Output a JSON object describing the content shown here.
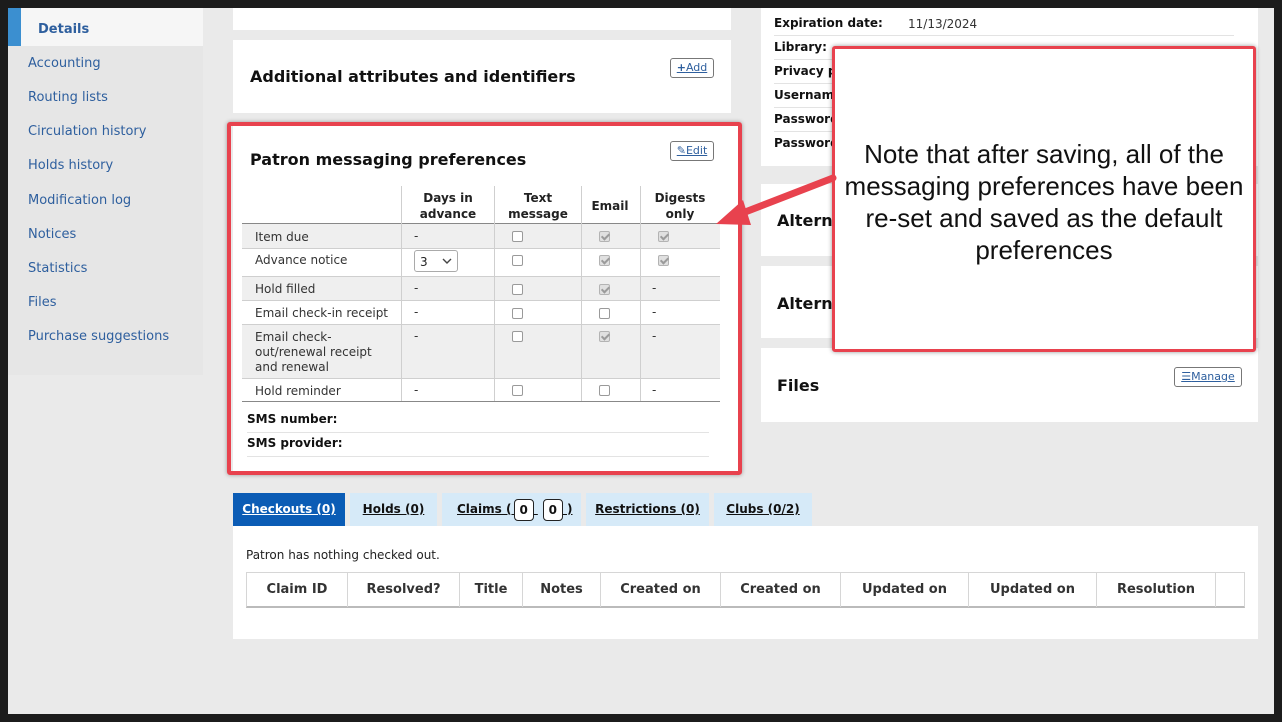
{
  "sidebar": {
    "active": "Details",
    "items": [
      "Accounting",
      "Routing lists",
      "Circulation history",
      "Holds history",
      "Modification log",
      "Notices",
      "Statistics",
      "Files",
      "Purchase suggestions"
    ]
  },
  "attributes_panel": {
    "title": "Additional attributes and identifiers",
    "add_label": "Add"
  },
  "messaging": {
    "title": "Patron messaging preferences",
    "edit_label": "Edit",
    "columns": [
      "Days in advance",
      "Text message",
      "Email",
      "Digests only"
    ],
    "rows": [
      {
        "label": "Item due",
        "days": "-",
        "text": false,
        "email": true,
        "digest": true,
        "digest_text": ""
      },
      {
        "label": "Advance notice",
        "days": "3",
        "text": false,
        "email": true,
        "digest": true,
        "digest_text": ""
      },
      {
        "label": "Hold filled",
        "days": "-",
        "text": false,
        "email": true,
        "digest": false,
        "digest_text": "-"
      },
      {
        "label": "Email check-in receipt",
        "days": "-",
        "text": false,
        "email": false,
        "digest": false,
        "digest_text": "-"
      },
      {
        "label": "Email check-out/renewal receipt and renewal",
        "days": "-",
        "text": false,
        "email": true,
        "digest": false,
        "digest_text": "-"
      },
      {
        "label": "Hold reminder",
        "days": "-",
        "text": false,
        "email": false,
        "digest": false,
        "digest_text": "-"
      }
    ],
    "sms_number_label": "SMS number:",
    "sms_provider_label": "SMS provider:"
  },
  "patron_info": {
    "expiration_label": "Expiration date:",
    "expiration_value": "11/13/2024",
    "library_label": "Library:",
    "privacy_label": "Privacy p",
    "username_label": "Usernam",
    "password1_label": "Password",
    "password2_label": "Password"
  },
  "right_panels": {
    "alt1": "Alterna",
    "alt2": "Alterna",
    "files": "Files",
    "manage_label": "Manage"
  },
  "callout": "Note that after saving, all of the messaging preferences have been re-set and saved as the default preferences",
  "tabs": {
    "checkouts": "Checkouts (0)",
    "holds": "Holds (0)",
    "claims": "Claims (",
    "claims_badge1": "0",
    "claims_badge2": "0",
    "claims_close": ")",
    "restrictions": "Restrictions (0)",
    "clubs": "Clubs (0/2)"
  },
  "checkouts": {
    "empty_message": "Patron has nothing checked out.",
    "columns": [
      "Claim ID",
      "Resolved?",
      "Title",
      "Notes",
      "Created on",
      "Created on",
      "Updated on",
      "Updated on",
      "Resolution"
    ]
  },
  "colors": {
    "callout_border": "#e8424e",
    "active_tab": "#0b5cb5",
    "tab": "#d6eaf8",
    "link": "#2e5f9e"
  }
}
